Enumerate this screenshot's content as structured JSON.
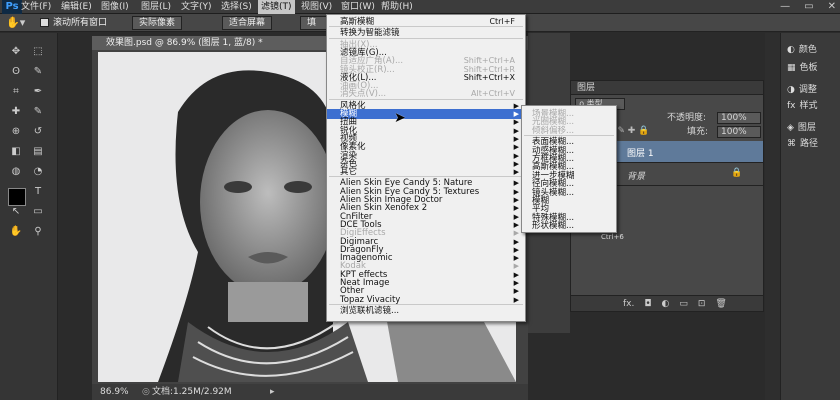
{
  "menubar": {
    "logo": "Ps",
    "items": [
      "文件(F)",
      "编辑(E)",
      "图像(I)",
      "图层(L)",
      "文字(Y)",
      "选择(S)",
      "滤镜(T)",
      "视图(V)",
      "窗口(W)",
      "帮助(H)"
    ],
    "active": 6
  },
  "options": {
    "scroll_all": "滚动所有窗口",
    "actual_pixels": "实际像素",
    "fit_screen": "适合屏幕",
    "fill_screen": "填充"
  },
  "document": {
    "tab": "效果图.psd @ 86.9% (图层 1, 蓝/8) *",
    "zoom": "86.9%",
    "doc_size": "文档:1.25M/2.92M"
  },
  "filter_menu": {
    "rows": [
      {
        "label": "高斯模糊",
        "shortcut": "Ctrl+F",
        "state": "normal"
      },
      {
        "sep": true
      },
      {
        "label": "转换为智能滤镜",
        "state": "normal"
      },
      {
        "sep": true
      },
      {
        "label": "抽出(X)...",
        "state": "dis"
      },
      {
        "label": "滤镜库(G)...",
        "state": "normal"
      },
      {
        "label": "自适应广角(A)...",
        "shortcut": "Shift+Ctrl+A",
        "state": "dis"
      },
      {
        "label": "镜头校正(R)...",
        "shortcut": "Shift+Ctrl+R",
        "state": "dis"
      },
      {
        "label": "液化(L)...",
        "shortcut": "Shift+Ctrl+X",
        "state": "normal"
      },
      {
        "label": "油画(O)...",
        "state": "dis"
      },
      {
        "label": "消失点(V)...",
        "shortcut": "Alt+Ctrl+V",
        "state": "dis"
      },
      {
        "sep": true
      },
      {
        "label": "风格化",
        "sub": true,
        "state": "normal"
      },
      {
        "label": "模糊",
        "sub": true,
        "state": "hl"
      },
      {
        "label": "扭曲",
        "sub": true,
        "state": "normal"
      },
      {
        "label": "锐化",
        "sub": true,
        "state": "normal"
      },
      {
        "label": "视频",
        "sub": true,
        "state": "normal"
      },
      {
        "label": "像素化",
        "sub": true,
        "state": "normal"
      },
      {
        "label": "渲染",
        "sub": true,
        "state": "normal"
      },
      {
        "label": "杂色",
        "sub": true,
        "state": "normal"
      },
      {
        "label": "其它",
        "sub": true,
        "state": "normal"
      },
      {
        "sep": true
      },
      {
        "label": "Alien Skin Eye Candy 5: Nature",
        "sub": true,
        "state": "normal"
      },
      {
        "label": "Alien Skin Eye Candy 5: Textures",
        "sub": true,
        "state": "normal"
      },
      {
        "label": "Alien Skin Image Doctor",
        "sub": true,
        "state": "normal"
      },
      {
        "label": "Alien Skin Xenofex 2",
        "sub": true,
        "state": "normal"
      },
      {
        "label": "CnFilter",
        "sub": true,
        "state": "normal"
      },
      {
        "label": "DCE Tools",
        "sub": true,
        "state": "normal"
      },
      {
        "label": "DigiEffects",
        "sub": true,
        "state": "dis"
      },
      {
        "label": "Digimarc",
        "sub": true,
        "state": "normal"
      },
      {
        "label": "DragonFly",
        "sub": true,
        "state": "normal"
      },
      {
        "label": "Imagenomic",
        "sub": true,
        "state": "normal"
      },
      {
        "label": "Kodak",
        "sub": true,
        "state": "dis"
      },
      {
        "label": "KPT effects",
        "sub": true,
        "state": "normal"
      },
      {
        "label": "Neat Image",
        "sub": true,
        "state": "normal"
      },
      {
        "label": "Other",
        "sub": true,
        "state": "normal"
      },
      {
        "label": "Topaz Vivacity",
        "sub": true,
        "state": "normal"
      },
      {
        "sep": true
      },
      {
        "label": "浏览联机滤镜...",
        "state": "normal"
      }
    ]
  },
  "blur_submenu": {
    "items": [
      {
        "label": "场景模糊...",
        "state": "dis"
      },
      {
        "label": "光圈模糊...",
        "state": "dis"
      },
      {
        "label": "倾斜偏移...",
        "state": "dis"
      },
      {
        "sep": true
      },
      {
        "label": "表面模糊...",
        "state": "normal"
      },
      {
        "label": "动感模糊...",
        "state": "normal"
      },
      {
        "label": "方框模糊...",
        "state": "normal"
      },
      {
        "label": "高斯模糊...",
        "state": "normal"
      },
      {
        "label": "进一步模糊",
        "state": "normal"
      },
      {
        "label": "径向模糊...",
        "state": "normal"
      },
      {
        "label": "镜头模糊...",
        "state": "normal"
      },
      {
        "label": "模糊",
        "state": "normal"
      },
      {
        "label": "平均",
        "state": "normal"
      },
      {
        "label": "特殊模糊...",
        "state": "normal"
      },
      {
        "label": "形状模糊...",
        "state": "normal"
      }
    ]
  },
  "layers": {
    "title": "图层",
    "kind": "ρ 类型",
    "opacity_label": "不透明度:",
    "opacity": "100%",
    "fill_label": "填充:",
    "fill": "100%",
    "layer1": "图层 1",
    "background": "背景",
    "shortcut_hint": "Ctrl+6"
  },
  "right_panel": {
    "color": "颜色",
    "swatches": "色板",
    "adjust": "调整",
    "styles": "样式",
    "layers": "图层",
    "paths": "路径"
  }
}
